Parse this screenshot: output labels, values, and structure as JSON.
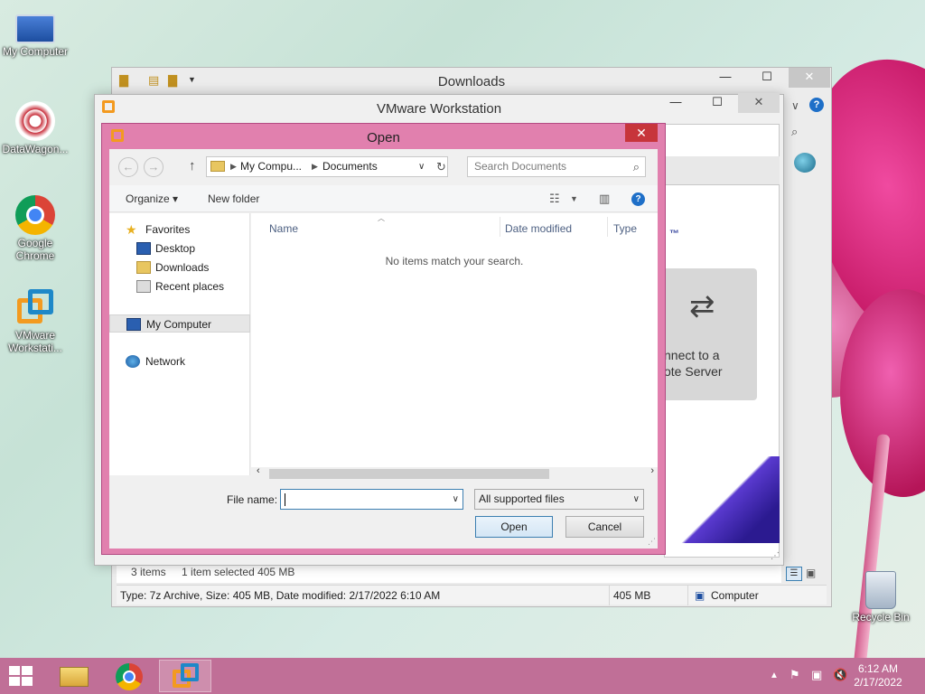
{
  "desktop": {
    "icons": [
      {
        "label": "My Computer",
        "icon": "computer-icon"
      },
      {
        "label": "DataWagon...",
        "icon": "datawagon-icon"
      },
      {
        "label": "Google Chrome",
        "icon": "chrome-icon"
      },
      {
        "label": "VMware Workstati...",
        "icon": "vmware-icon"
      },
      {
        "label": "Recycle Bin",
        "icon": "recycle-bin-icon"
      }
    ]
  },
  "downloads_window": {
    "title": "Downloads",
    "items_count": "3 items",
    "selection": "1 item selected  405 MB",
    "status_details": "Type: 7z Archive, Size: 405 MB, Date modified: 2/17/2022 6:10 AM",
    "status_size": "405 MB",
    "status_location": "Computer"
  },
  "vmware_window": {
    "title": "VMware Workstation",
    "tm": "™",
    "card_line1": "nnect to a",
    "card_line2": "ote Server"
  },
  "open_dialog": {
    "title": "Open",
    "address": {
      "segment1": "My Compu...",
      "segment2": "Documents"
    },
    "search_placeholder": "Search Documents",
    "commands": {
      "organize": "Organize ▾",
      "new_folder": "New folder"
    },
    "nav_pane": {
      "favorites": "Favorites",
      "desktop": "Desktop",
      "downloads": "Downloads",
      "recent": "Recent places",
      "my_computer": "My Computer",
      "network": "Network"
    },
    "columns": {
      "name": "Name",
      "date_modified": "Date modified",
      "type": "Type"
    },
    "empty_message": "No items match your search.",
    "file_name_label": "File name:",
    "file_name_value": "",
    "file_type": "All supported files",
    "open_button": "Open",
    "cancel_button": "Cancel"
  },
  "taskbar": {
    "clock_time": "6:12 AM",
    "clock_date": "2/17/2022"
  },
  "colors": {
    "dialog_frame": "#e180ae",
    "taskbar": "#c06f97",
    "close_button": "#c7353b"
  }
}
